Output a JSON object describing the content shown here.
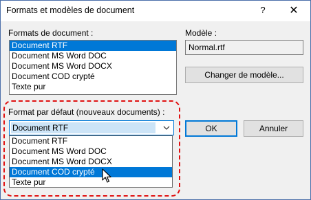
{
  "dialog": {
    "title": "Formats et modèles de document",
    "help_glyph": "?",
    "close_glyph": "✕"
  },
  "formats": {
    "label": "Formats de document :",
    "items": [
      {
        "label": "Document RTF",
        "selected": true
      },
      {
        "label": "Document MS Word DOC",
        "selected": false
      },
      {
        "label": "Document MS Word DOCX",
        "selected": false
      },
      {
        "label": "Document COD crypté",
        "selected": false
      },
      {
        "label": "Texte pur",
        "selected": false
      }
    ]
  },
  "template": {
    "label": "Modèle :",
    "value": "Normal.rtf",
    "change_button": "Changer de modèle..."
  },
  "default_format": {
    "label": "Format par défaut (nouveaux documents) :",
    "selected": "Document RTF",
    "options": [
      {
        "label": "Document RTF",
        "highlighted": false
      },
      {
        "label": "Document MS Word DOC",
        "highlighted": false
      },
      {
        "label": "Document MS Word DOCX",
        "highlighted": false
      },
      {
        "label": "Document COD crypté",
        "highlighted": true
      },
      {
        "label": "Texte pur",
        "highlighted": false
      }
    ]
  },
  "buttons": {
    "ok": "OK",
    "cancel": "Annuler"
  },
  "icons": {
    "help": "help-icon",
    "close": "close-icon",
    "dropdown": "chevron-down-icon",
    "cursor": "mouse-pointer-icon"
  },
  "colors": {
    "selection": "#0078d7",
    "annotation": "#e01010",
    "window_border": "#4a6ea9"
  }
}
